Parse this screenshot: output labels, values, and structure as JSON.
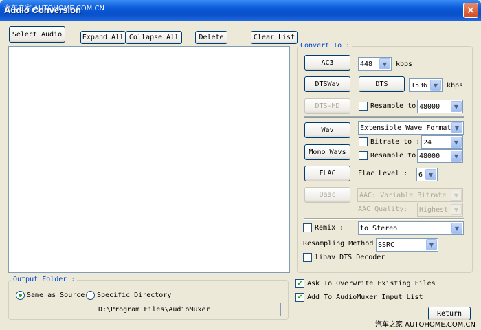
{
  "window": {
    "title": "Audio Conversion",
    "watermark_top": "汽车之家 AUTOHOME.COM.CN",
    "close_glyph": "✕"
  },
  "toolbar": {
    "select_audio": "Select Audio",
    "expand_all": "Expand All",
    "collapse_all": "Collapse All",
    "delete": "Delete",
    "clear_list": "Clear List"
  },
  "convert_to": {
    "label": "Convert To :",
    "ac3": "AC3",
    "ac3_bitrate": "448",
    "ac3_unit": "kbps",
    "dtswav": "DTSWav",
    "dts": "DTS",
    "dts_bitrate": "1536",
    "dts_unit": "kbps",
    "dtshd": "DTS-HD",
    "resample_label": "Resample to",
    "resample_value": "48000",
    "wav": "Wav",
    "wav_format": "Extensible Wave Format",
    "bitrate_label": "Bitrate to :",
    "bitrate_value": "24",
    "wav_resample_label": "Resample to",
    "wav_resample_value": "48000",
    "mono_wavs": "Mono Wavs",
    "flac": "FLAC",
    "flac_level_label": "Flac Level :",
    "flac_level_value": "6",
    "qaac": "Qaac",
    "aac_mode": "AAC: Variable Bitrate",
    "aac_quality_label": "AAC Quality:",
    "aac_quality_value": "Highest",
    "remix_label": "Remix :",
    "remix_value": "to Stereo",
    "resampling_method_label": "Resampling Method",
    "resampling_method_value": "SSRC",
    "libav_label": "libav DTS Decoder"
  },
  "options": {
    "ask_overwrite": "Ask To Overwrite Existing Files",
    "add_to_input": "Add To AudioMuxer Input List",
    "check_glyph": "✔"
  },
  "output_folder": {
    "label": "Output Folder :",
    "same_as_source": "Same as Source",
    "specific_directory": "Specific Directory",
    "path": "D:\\Program Files\\AudioMuxer"
  },
  "return": "Return",
  "watermark_bottom": "汽车之家 AUTOHOME.COM.CN",
  "icons": {
    "dropdown": "▼"
  }
}
